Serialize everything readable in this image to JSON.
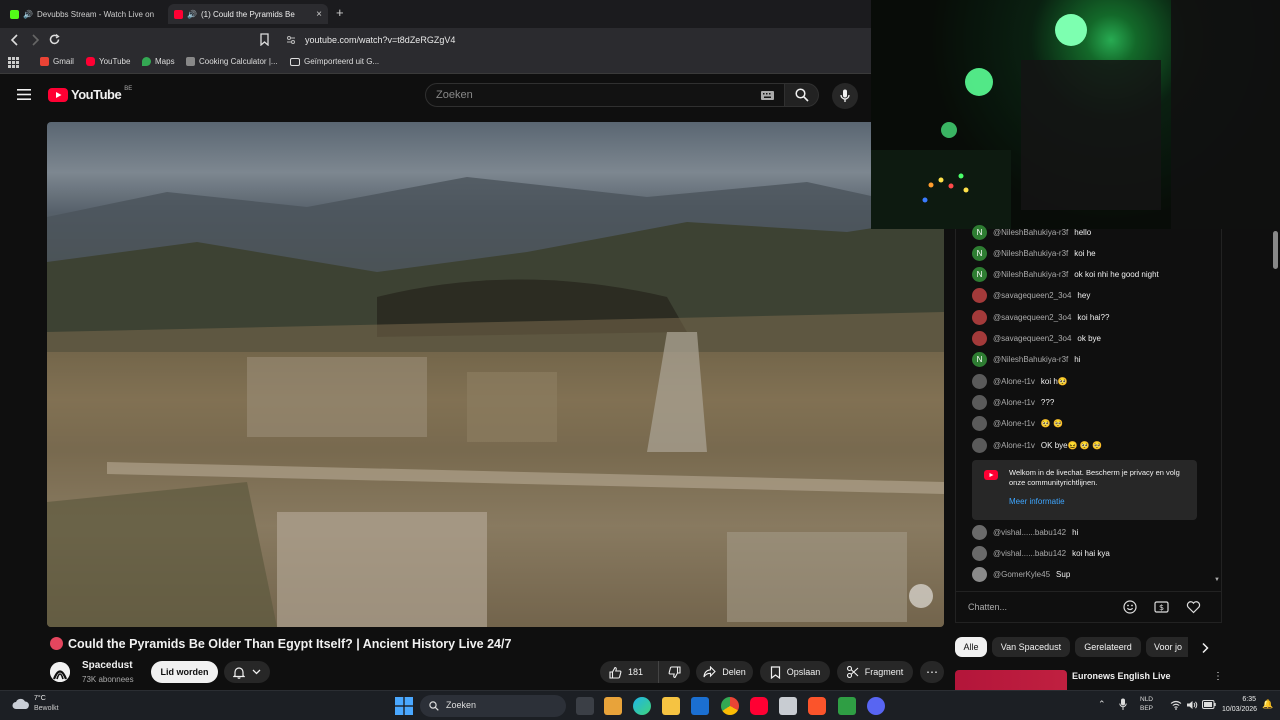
{
  "browser": {
    "tabs": [
      {
        "title": "Devubbs Stream - Watch Live on",
        "favicon_color": "#53fc18"
      },
      {
        "title": "(1) Could the Pyramids Be",
        "favicon_color": "#ff0033"
      }
    ],
    "url": "youtube.com/watch?v=t8dZeRGZgV4",
    "bookmarks": [
      {
        "label": "Gmail",
        "color": "#ea4335"
      },
      {
        "label": "YouTube",
        "color": "#ff0033"
      },
      {
        "label": "Maps",
        "color": "#34a853"
      },
      {
        "label": "Cooking Calculator |...",
        "color": "#888888"
      },
      {
        "label": "Geïmporteerd uit G...",
        "color": "#dddddd"
      }
    ]
  },
  "youtube": {
    "logo_text": "YouTube",
    "region": "BE",
    "search_placeholder": "Zoeken"
  },
  "video": {
    "title": "Could the Pyramids Be Older Than Egypt Itself? | Ancient History Live 24/7",
    "channel": "Spacedust",
    "subscribers": "73K abonnees",
    "join_label": "Lid worden",
    "likes": "181",
    "share_label": "Delen",
    "save_label": "Opslaan",
    "clip_label": "Fragment"
  },
  "chat": {
    "messages": [
      {
        "author": "@NileshBahukiya-r3f",
        "text": "hello",
        "avatar": "N",
        "color": "#2e7d32"
      },
      {
        "author": "@NileshBahukiya-r3f",
        "text": "koi he",
        "avatar": "N",
        "color": "#2e7d32"
      },
      {
        "author": "@NileshBahukiya-r3f",
        "text": "ok koi nhi he good night",
        "avatar": "N",
        "color": "#2e7d32"
      },
      {
        "author": "@savagequeen2_3o4",
        "text": "hey",
        "avatar": "",
        "color": "#a33a3a"
      },
      {
        "author": "@savagequeen2_3o4",
        "text": "koi hai??",
        "avatar": "",
        "color": "#a33a3a"
      },
      {
        "author": "@savagequeen2_3o4",
        "text": "ok bye",
        "avatar": "",
        "color": "#a33a3a"
      },
      {
        "author": "@NileshBahukiya-r3f",
        "text": "hi",
        "avatar": "N",
        "color": "#2e7d32"
      },
      {
        "author": "@Alone-t1v",
        "text": "koi h🥺",
        "avatar": "",
        "color": "#5a5a5a"
      },
      {
        "author": "@Alone-t1v",
        "text": "???",
        "avatar": "",
        "color": "#5a5a5a"
      },
      {
        "author": "@Alone-t1v",
        "text": "🥺 🥺",
        "avatar": "",
        "color": "#5a5a5a"
      },
      {
        "author": "@Alone-t1v",
        "text": "OK bye😖 🥺 🥺",
        "avatar": "",
        "color": "#5a5a5a"
      }
    ],
    "notice": {
      "text": "Welkom in de livechat. Bescherm je privacy en volg onze communityrichtlijnen.",
      "link": "Meer informatie"
    },
    "messages_after": [
      {
        "author": "@vishal......babu142",
        "text": "hi",
        "avatar": "",
        "color": "#6a6a6a"
      },
      {
        "author": "@vishal......babu142",
        "text": "koi hai kya",
        "avatar": "",
        "color": "#6a6a6a"
      },
      {
        "author": "@GomerKyle45",
        "text": "Sup",
        "avatar": "",
        "color": "#8a8a8a"
      }
    ],
    "input_placeholder": "Chatten..."
  },
  "chips": [
    "Alle",
    "Van Spacedust",
    "Gerelateerd",
    "Voor jo"
  ],
  "recommendation": {
    "title": "Euronews English Live"
  },
  "taskbar": {
    "weather_temp": "7°C",
    "weather_desc": "Bewolkt",
    "search_label": "Zoeken",
    "lang_top": "NLD",
    "lang_bottom": "BEP",
    "time": "6:35",
    "date": "10/03/2026"
  }
}
